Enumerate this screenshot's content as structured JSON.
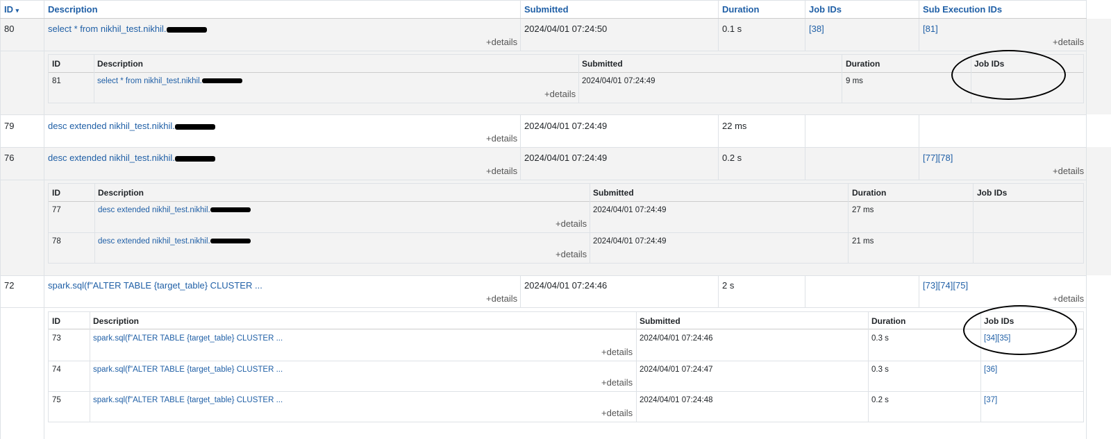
{
  "header": {
    "id": "ID",
    "sort_indicator": "▾",
    "description": "Description",
    "submitted": "Submitted",
    "duration": "Duration",
    "job_ids": "Job IDs",
    "sub_execution_ids": "Sub Execution IDs"
  },
  "details_label": "+details",
  "sub_header": {
    "id": "ID",
    "description": "Description",
    "submitted": "Submitted",
    "duration": "Duration",
    "job_ids": "Job IDs"
  },
  "rows": [
    {
      "id": "80",
      "description": "select * from nikhil_test.nikhil.",
      "submitted": "2024/04/01 07:24:50",
      "duration": "0.1 s",
      "job_ids": "[38]",
      "sub_ids": "[81]"
    },
    {
      "id": "79",
      "description": "desc extended nikhil_test.nikhil.",
      "submitted": "2024/04/01 07:24:49",
      "duration": "22 ms",
      "job_ids": "",
      "sub_ids": ""
    },
    {
      "id": "76",
      "description": "desc extended nikhil_test.nikhil.",
      "submitted": "2024/04/01 07:24:49",
      "duration": "0.2 s",
      "job_ids": "",
      "sub_ids": "[77][78]"
    },
    {
      "id": "72",
      "description": "spark.sql(f\"ALTER TABLE {target_table} CLUSTER ...",
      "submitted": "2024/04/01 07:24:46",
      "duration": "2 s",
      "job_ids": "",
      "sub_ids": "[73][74][75]"
    }
  ],
  "sub_rows_80": [
    {
      "id": "81",
      "description": "select * from nikhil_test.nikhil.",
      "submitted": "2024/04/01 07:24:49",
      "duration": "9 ms",
      "job_ids": ""
    }
  ],
  "sub_rows_76": [
    {
      "id": "77",
      "description": "desc extended nikhil_test.nikhil.",
      "submitted": "2024/04/01 07:24:49",
      "duration": "27 ms",
      "job_ids": ""
    },
    {
      "id": "78",
      "description": "desc extended nikhil_test.nikhil.",
      "submitted": "2024/04/01 07:24:49",
      "duration": "21 ms",
      "job_ids": ""
    }
  ],
  "sub_rows_72": [
    {
      "id": "73",
      "description": "spark.sql(f\"ALTER TABLE {target_table} CLUSTER ...",
      "submitted": "2024/04/01 07:24:46",
      "duration": "0.3 s",
      "job_ids": "[34][35]"
    },
    {
      "id": "74",
      "description": "spark.sql(f\"ALTER TABLE {target_table} CLUSTER ...",
      "submitted": "2024/04/01 07:24:47",
      "duration": "0.3 s",
      "job_ids": "[36]"
    },
    {
      "id": "75",
      "description": "spark.sql(f\"ALTER TABLE {target_table} CLUSTER ...",
      "submitted": "2024/04/01 07:24:48",
      "duration": "0.2 s",
      "job_ids": "[37]"
    }
  ],
  "colors": {
    "link": "#1f5fa6",
    "stripe": "#f3f3f3",
    "border": "#dee2e6"
  }
}
